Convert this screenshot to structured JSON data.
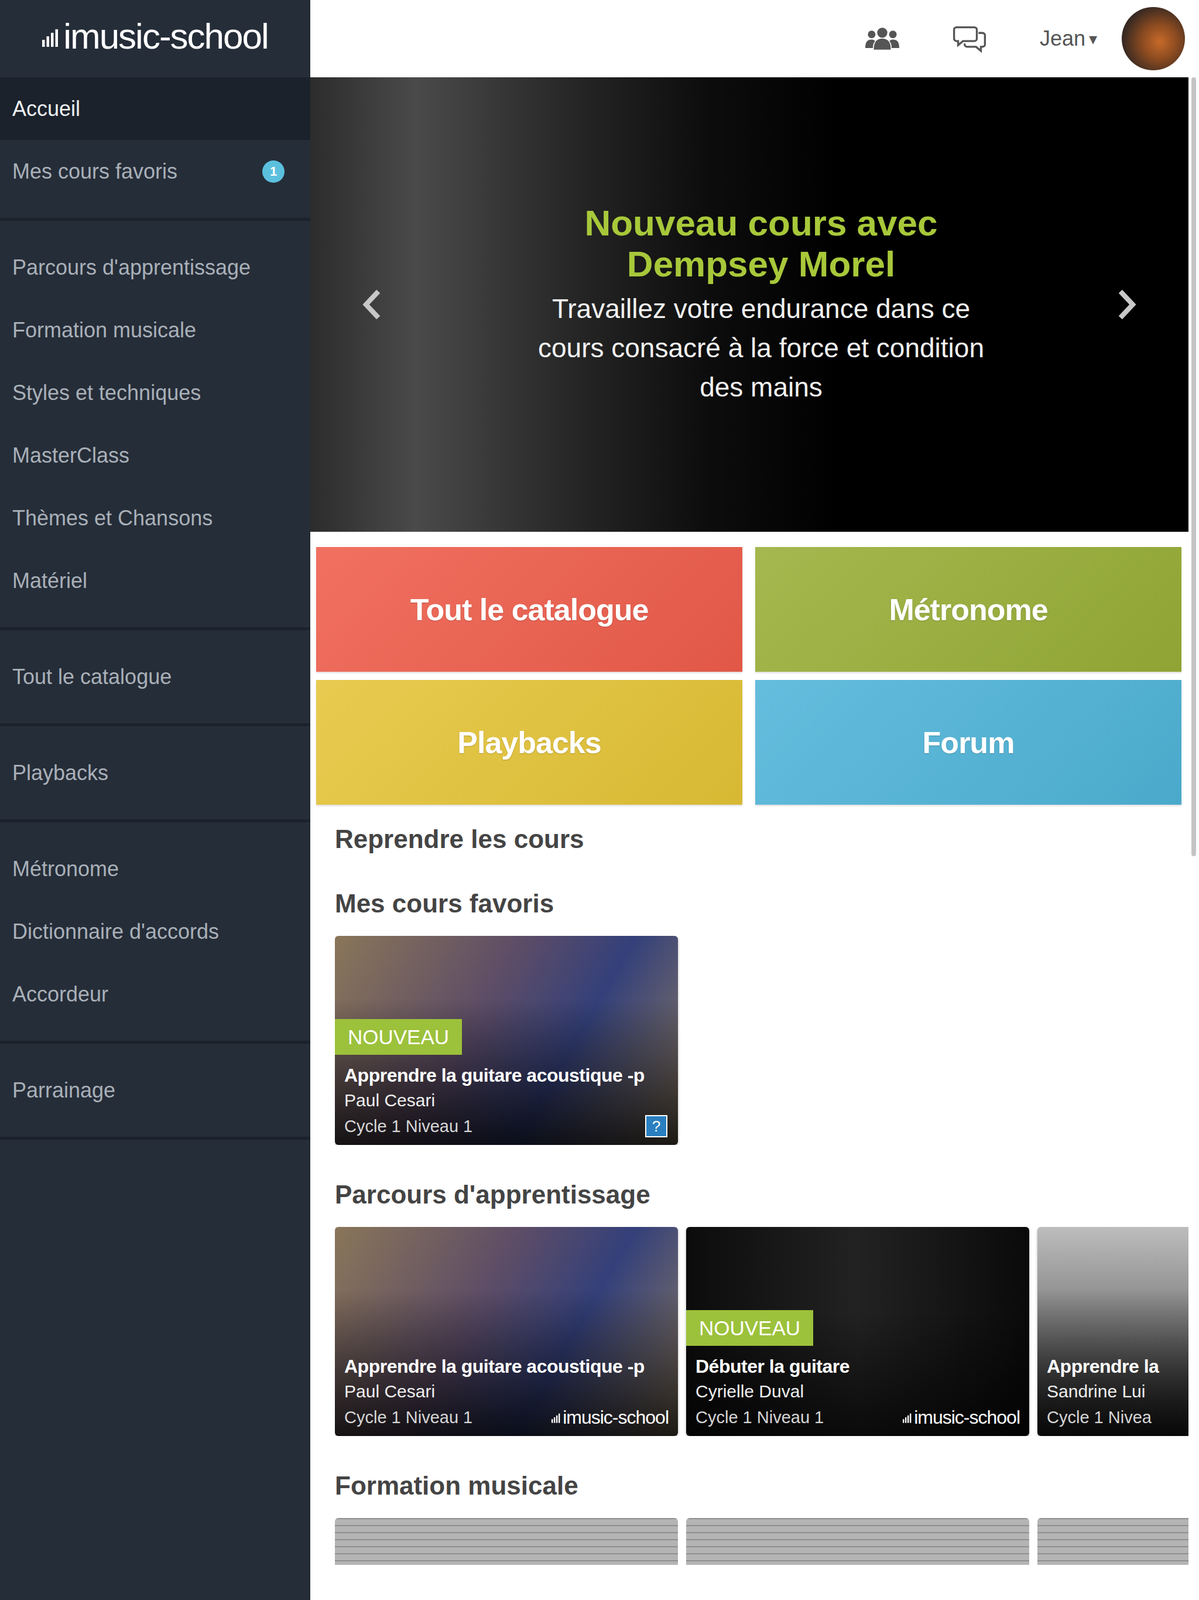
{
  "logo": "imusic-school",
  "sidebar": {
    "groups": [
      {
        "items": [
          {
            "label": "Accueil",
            "selected": true,
            "badge": null
          },
          {
            "label": "Mes cours favoris",
            "selected": false,
            "badge": "1"
          }
        ]
      },
      {
        "items": [
          {
            "label": "Parcours d'apprentissage",
            "selected": false,
            "badge": null
          },
          {
            "label": "Formation musicale",
            "selected": false,
            "badge": null
          },
          {
            "label": "Styles et techniques",
            "selected": false,
            "badge": null
          },
          {
            "label": "MasterClass",
            "selected": false,
            "badge": null
          },
          {
            "label": "Thèmes et Chansons",
            "selected": false,
            "badge": null
          },
          {
            "label": "Matériel",
            "selected": false,
            "badge": null
          }
        ]
      },
      {
        "items": [
          {
            "label": "Tout le catalogue",
            "selected": false,
            "badge": null
          }
        ]
      },
      {
        "items": [
          {
            "label": "Playbacks",
            "selected": false,
            "badge": null
          }
        ]
      },
      {
        "items": [
          {
            "label": "Métronome",
            "selected": false,
            "badge": null
          },
          {
            "label": "Dictionnaire d'accords",
            "selected": false,
            "badge": null
          },
          {
            "label": "Accordeur",
            "selected": false,
            "badge": null
          }
        ]
      },
      {
        "items": [
          {
            "label": "Parrainage",
            "selected": false,
            "badge": null
          }
        ]
      }
    ]
  },
  "header": {
    "user": "Jean",
    "caret": "▾"
  },
  "banner": {
    "title_lines": [
      "Nouveau cours avec",
      "Dempsey Morel"
    ],
    "subtitle_lines": [
      "Travaillez votre endurance dans ce",
      "cours consacré à la force et condition",
      "des mains"
    ]
  },
  "tiles": [
    {
      "label": "Tout le catalogue",
      "color": "#ef5d4b"
    },
    {
      "label": "Métronome",
      "color": "#98ae37"
    },
    {
      "label": "Playbacks",
      "color": "#e5c437"
    },
    {
      "label": "Forum",
      "color": "#4fb4d8"
    }
  ],
  "sections": [
    {
      "title": "Reprendre les cours",
      "kind": "empty",
      "cards": []
    },
    {
      "title": "Mes cours favoris",
      "kind": "cards",
      "cards": [
        {
          "badge": "NOUVEAU",
          "title": "Apprendre la guitare acoustique -p",
          "author": "Paul Cesari",
          "level": "Cycle 1 Niveau 1",
          "logo": null,
          "help": "?"
        }
      ]
    },
    {
      "title": "Parcours d'apprentissage",
      "kind": "cards",
      "cards": [
        {
          "badge": null,
          "title": "Apprendre la guitare acoustique -p",
          "author": "Paul Cesari",
          "level": "Cycle 1 Niveau 1",
          "logo": "imusic-school",
          "help": null
        },
        {
          "badge": "NOUVEAU",
          "title": "Débuter la guitare",
          "author": "Cyrielle Duval",
          "level": "Cycle 1 Niveau 1",
          "logo": "imusic-school",
          "help": null
        },
        {
          "badge": null,
          "title": "Apprendre la",
          "author": "Sandrine Lui",
          "level": "Cycle 1 Nivea",
          "logo": null,
          "help": null
        }
      ]
    },
    {
      "title": "Formation musicale",
      "kind": "thumbnails",
      "cards": []
    }
  ]
}
